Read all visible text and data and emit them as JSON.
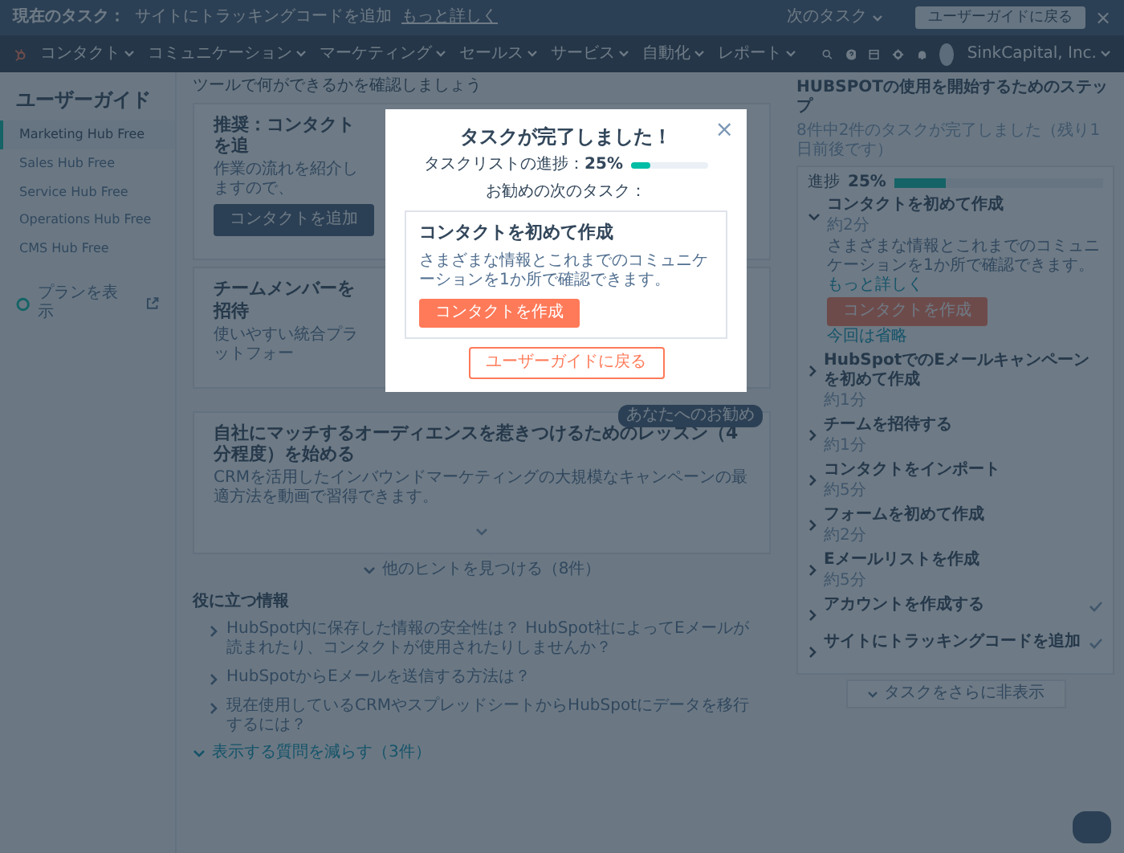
{
  "banner": {
    "label": "現在のタスク：",
    "task": "サイトにトラッキングコードを追加",
    "link": "もっと詳しく",
    "next_task": "次のタスク",
    "guide_button": "ユーザーガイドに戻る",
    "close": "×"
  },
  "nav": {
    "items": [
      "コンタクト",
      "コミュニケーション",
      "マーケティング",
      "セールス",
      "サービス",
      "自動化",
      "レポート"
    ],
    "account": "SinkCapital, Inc."
  },
  "sidebar": {
    "title": "ユーザーガイド",
    "items": [
      {
        "label": "Marketing Hub Free",
        "selected": true
      },
      {
        "label": "Sales Hub Free",
        "selected": false
      },
      {
        "label": "Service Hub Free",
        "selected": false
      },
      {
        "label": "Operations Hub Free",
        "selected": false
      },
      {
        "label": "CMS Hub Free",
        "selected": false
      }
    ],
    "plan_link": "プランを表示"
  },
  "main": {
    "intro": "ツールで何ができるかを確認しましょう",
    "cards": [
      {
        "title": "推奨：コンタクトを追",
        "description": "作業の流れを紹介しますので、",
        "button": "コンタクトを追加"
      },
      {
        "title": "チームメンバーを招待",
        "description": "使いやすい統合プラットフォー"
      },
      {
        "badge": "あなたへのお勧め",
        "title": "自社にマッチするオーディエンスを惹きつけるためのレッスン（4分程度）を始める",
        "description": "CRMを活用したインバウンドマーケティングの大規模なキャンペーンの最適方法を動画で習得できます。"
      }
    ],
    "more_tips": "他のヒントを見つける（8件）",
    "info": {
      "title": "役に立つ情報",
      "questions": [
        "HubSpot内に保存した情報の安全性は？ HubSpot社によってEメールが読まれたり、コンタクトが使用されたりしませんか？",
        "HubSpotからEメールを送信する方法は？",
        "現在使用しているCRMやスプレッドシートからHubSpotにデータを移行するには？"
      ],
      "less_link": "表示する質問を減らす（3件）"
    }
  },
  "steps": {
    "title": "HUBSPOTの使用を開始するためのステップ",
    "subtitle": "8件中2件のタスクが完了しました（残り1日前後です）",
    "progress_label": "進捗",
    "progress_value": "25%",
    "level": 0.25,
    "tasks": [
      {
        "title": "コンタクトを初めて作成",
        "duration": "約2分",
        "expanded": true,
        "done": false,
        "description": "さまざまな情報とこれまでのコミュニケーションを1か所で確認できます。",
        "link": "もっと詳しく",
        "button": "コンタクトを作成",
        "skip": "今回は省略"
      },
      {
        "title": "HubSpotでのEメールキャンペーンを初めて作成",
        "duration": "約1分",
        "expanded": false,
        "done": false
      },
      {
        "title": "チームを招待する",
        "duration": "約1分",
        "expanded": false,
        "done": false
      },
      {
        "title": "コンタクトをインポート",
        "duration": "約5分",
        "expanded": false,
        "done": false
      },
      {
        "title": "フォームを初めて作成",
        "duration": "約2分",
        "expanded": false,
        "done": false
      },
      {
        "title": "Eメールリストを作成",
        "duration": "約5分",
        "expanded": false,
        "done": false
      },
      {
        "title": "アカウントを作成する",
        "expanded": false,
        "done": true
      },
      {
        "title": "サイトにトラッキングコードを追加",
        "expanded": false,
        "done": true
      }
    ],
    "hide_link": "タスクをさらに非表示"
  },
  "modal": {
    "close": "×",
    "title": "タスクが完了しました！",
    "progress_label": "タスクリストの進捗：**25%**",
    "level": 0.25,
    "next_label": "お勧めの次のタスク：",
    "task": {
      "title": "コンタクトを初めて作成",
      "description": "さまざまな情報とこれまでのコミュニケーションを1か所で確認できます。",
      "button": "コンタクトを作成"
    },
    "back_button": "ユーザーガイドに戻る"
  }
}
